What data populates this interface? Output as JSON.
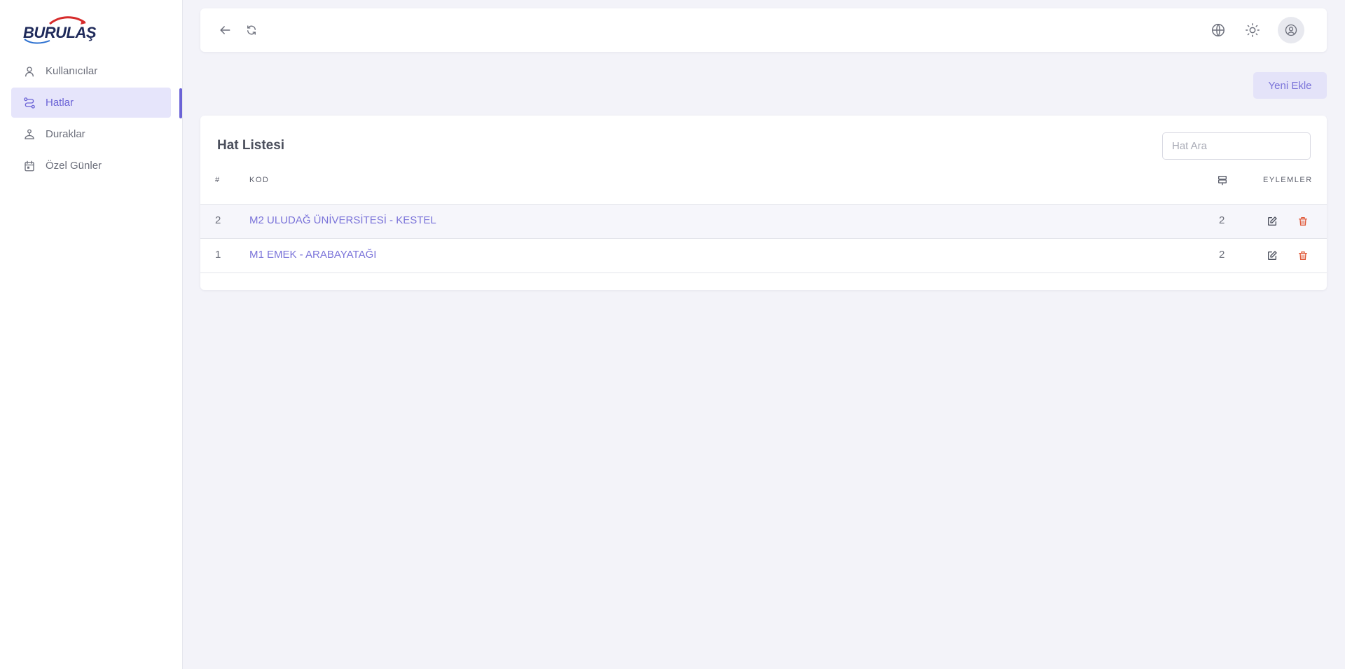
{
  "brand": {
    "logo_text": "BURULAŞ"
  },
  "sidebar": {
    "items": [
      {
        "label": "Kullanıcılar",
        "icon": "user-icon"
      },
      {
        "label": "Hatlar",
        "icon": "route-icon",
        "active": true
      },
      {
        "label": "Duraklar",
        "icon": "bus-stop-icon"
      },
      {
        "label": "Özel Günler",
        "icon": "calendar-icon"
      }
    ]
  },
  "topbar": {
    "icons": [
      "back-arrow-icon",
      "refresh-icon",
      "globe-icon",
      "sun-icon",
      "user-circle-icon"
    ]
  },
  "actions": {
    "new_label": "Yeni Ekle"
  },
  "table": {
    "title": "Hat Listesi",
    "search_placeholder": "Hat Ara",
    "headers": {
      "index": "#",
      "code": "KOD",
      "count_icon": "signpost-icon",
      "actions": "EYLEMLER"
    },
    "rows": [
      {
        "index": "2",
        "code": "M2 ULUDAĞ ÜNİVERSİTESİ - KESTEL",
        "count": "2"
      },
      {
        "index": "1",
        "code": "M1 EMEK - ARABAYATAĞI",
        "count": "2"
      }
    ]
  },
  "colors": {
    "accent": "#6b63d6",
    "delete": "#e05a3a",
    "background": "#f3f3f9"
  }
}
